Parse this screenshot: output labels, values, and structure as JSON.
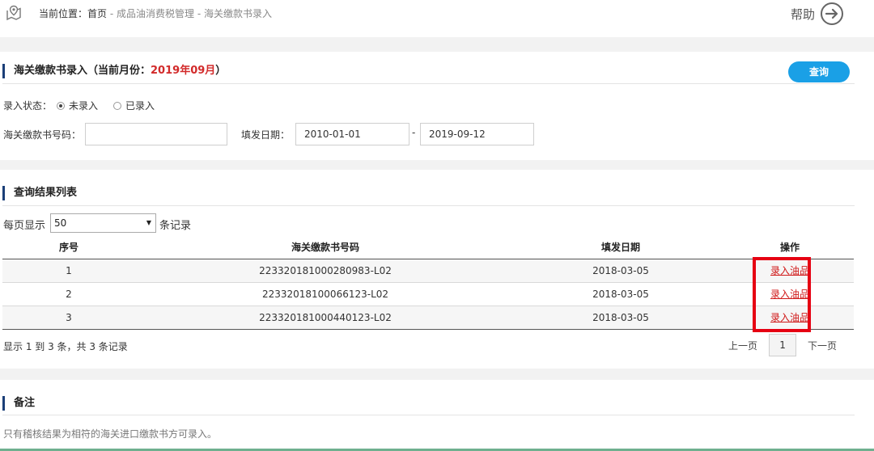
{
  "breadcrumb": {
    "prefix": "当前位置：",
    "home": "首页",
    "sep1": " - ",
    "section": "成品油消费税管理",
    "sep2": " - ",
    "current": "海关缴款书录入"
  },
  "help": {
    "label": "帮助"
  },
  "entry_panel": {
    "title": "海关缴款书录入（当前月份：",
    "month": "2019年09月",
    "title_end": "）",
    "query_button": "查询",
    "status_label": "录入状态：",
    "status_options": [
      {
        "label": "未录入",
        "checked": true
      },
      {
        "label": "已录入",
        "checked": false
      }
    ],
    "number_label": "海关缴款书号码：",
    "number_value": "",
    "date_label": "填发日期：",
    "date_from": "2010-01-01",
    "date_sep": "-",
    "date_to": "2019-09-12"
  },
  "results_panel": {
    "title": "查询结果列表",
    "per_page_label": "每页显示",
    "per_page_value": "50",
    "per_page_suffix": "条记录",
    "columns": [
      "序号",
      "海关缴款书号码",
      "填发日期",
      "操作"
    ],
    "rows": [
      {
        "index": "1",
        "number": "223320181000280983-L02",
        "date": "2018-03-05",
        "action": "录入油品"
      },
      {
        "index": "2",
        "number": "22332018100066123-L02",
        "date": "2018-03-05",
        "action": "录入油品"
      },
      {
        "index": "3",
        "number": "223320181000440123-L02",
        "date": "2018-03-05",
        "action": "录入油品"
      }
    ],
    "summary": "显示 1 到 3 条，共 3 条记录",
    "prev": "上一页",
    "page": "1",
    "next": "下一页"
  },
  "notes_panel": {
    "title": "备注",
    "text": "只有稽核结果为相符的海关进口缴款书方可录入。"
  },
  "colors": {
    "accent": "#1aa0e6",
    "title_bar": "#1b3f78",
    "highlight": "#e60012",
    "link": "#d01818",
    "month": "#d22a2a"
  }
}
